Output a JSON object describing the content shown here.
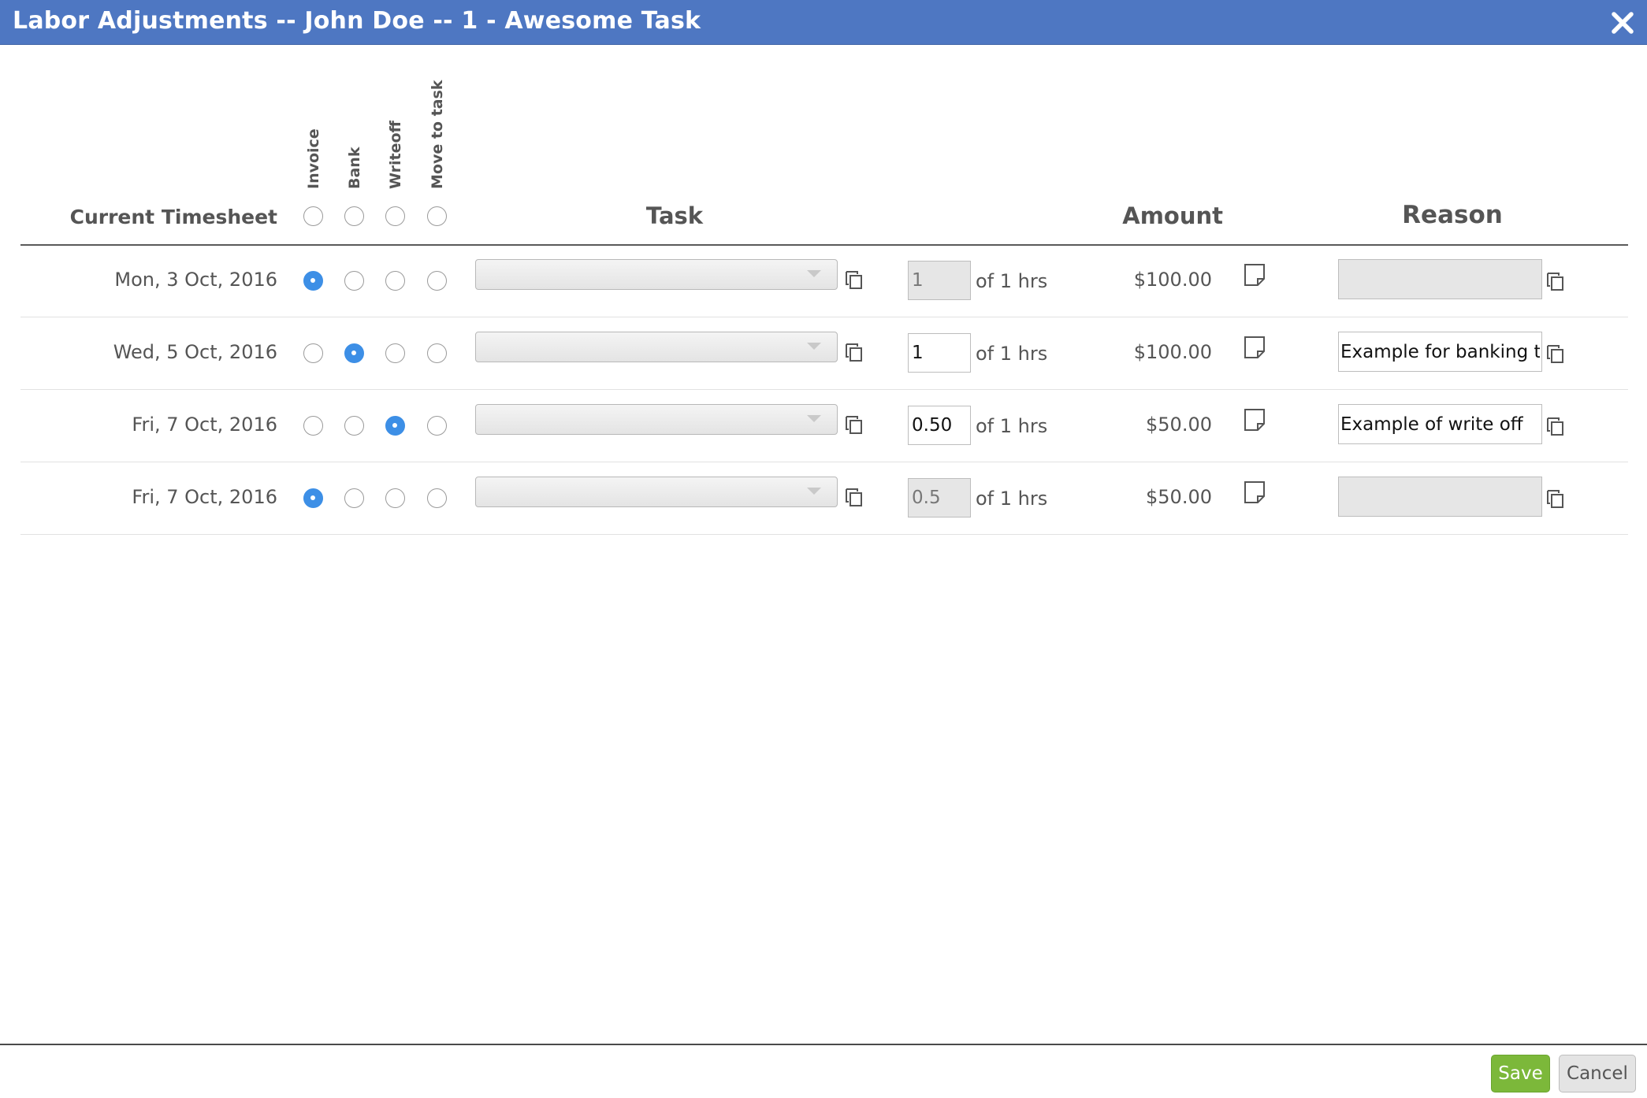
{
  "window": {
    "title": "Labor Adjustments -- John Doe -- 1 - Awesome Task",
    "close_icon": "close-icon"
  },
  "table": {
    "headers": {
      "current_timesheet": "Current Timesheet",
      "invoice": "Invoice",
      "bank": "Bank",
      "writeoff": "Writeoff",
      "move_to_task": "Move to task",
      "task": "Task",
      "amount": "Amount",
      "reason": "Reason"
    },
    "rows": [
      {
        "date": "Mon, 3 Oct, 2016",
        "selected_option": "Invoice",
        "task": "",
        "qty": "1",
        "qty_editable": false,
        "of_hrs": "of 1 hrs",
        "amount": "$100.00",
        "reason": "",
        "reason_editable": false
      },
      {
        "date": "Wed, 5 Oct, 2016",
        "selected_option": "Bank",
        "task": "",
        "qty": "1",
        "qty_editable": true,
        "of_hrs": "of 1 hrs",
        "amount": "$100.00",
        "reason": "Example for banking time",
        "reason_editable": true
      },
      {
        "date": "Fri, 7 Oct, 2016",
        "selected_option": "Writeoff",
        "task": "",
        "qty": "0.50",
        "qty_editable": true,
        "of_hrs": "of 1 hrs",
        "amount": "$50.00",
        "reason": "Example of write off",
        "reason_editable": true
      },
      {
        "date": "Fri, 7 Oct, 2016",
        "selected_option": "Invoice",
        "task": "",
        "qty": "0.5",
        "qty_editable": false,
        "of_hrs": "of 1 hrs",
        "amount": "$50.00",
        "reason": "",
        "reason_editable": false
      }
    ]
  },
  "footer": {
    "save_label": "Save",
    "cancel_label": "Cancel"
  },
  "colors": {
    "titlebar": "#4e77c2",
    "radio_selected": "#3d8fe6",
    "save_button": "#7cb83a"
  }
}
